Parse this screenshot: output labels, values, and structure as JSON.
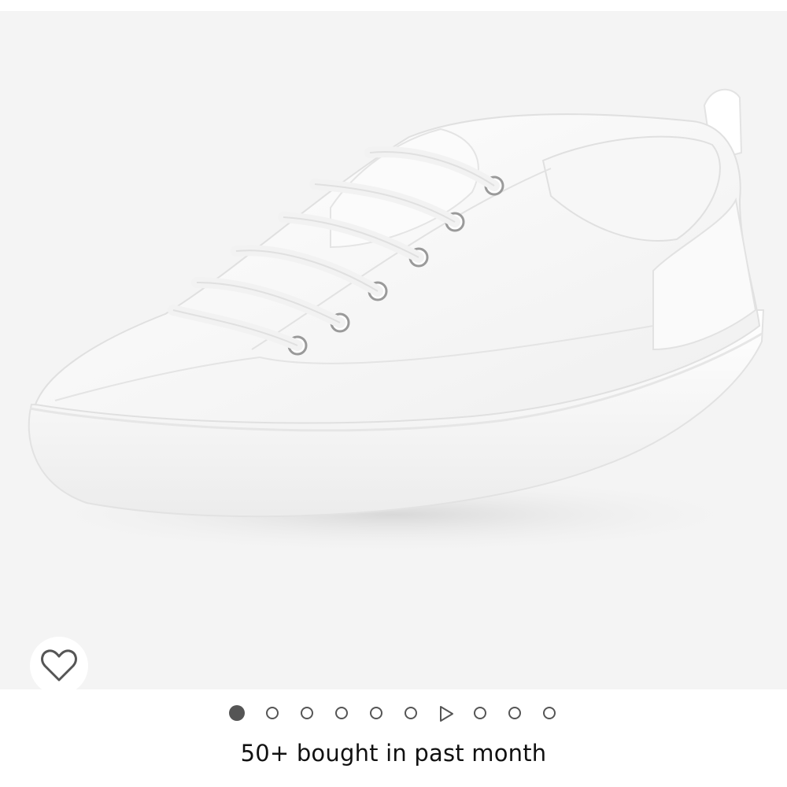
{
  "product": {
    "image_alt": "White leather lace-up sneaker",
    "image_icon": "sneaker-image"
  },
  "wishlist": {
    "icon": "heart-outline-icon"
  },
  "carousel": {
    "total": 10,
    "active_index": 0,
    "video_index": 6
  },
  "social_proof": {
    "text": "50+ bought in past month"
  },
  "colors": {
    "image_bg": "#f4f4f4",
    "dot": "#555555",
    "text": "#111111"
  }
}
